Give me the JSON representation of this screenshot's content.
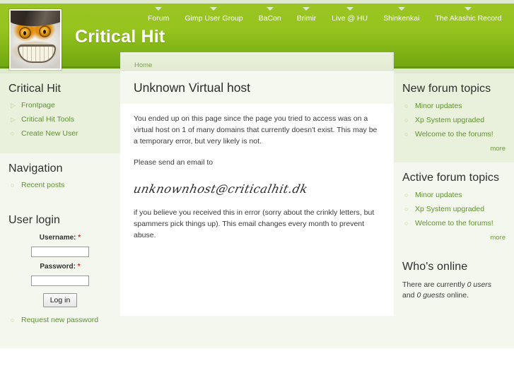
{
  "header": {
    "site_title": "Critical Hit",
    "logo_alt": "cat-mascot-logo",
    "nav": [
      {
        "label": "Forum"
      },
      {
        "label": "Gimp User Group"
      },
      {
        "label": "BaCon"
      },
      {
        "label": "Brimir"
      },
      {
        "label": "Live @ HU"
      },
      {
        "label": "Shinkenkai"
      },
      {
        "label": "The Akashic Record"
      }
    ]
  },
  "breadcrumb": {
    "items": [
      {
        "label": "Home"
      }
    ]
  },
  "main": {
    "title": "Unknown Virtual host",
    "paragraph1": "You ended up on this page since the page you tried to access was on a virtual host on 1 of many domains that currently doesn't exist. This may be a temporary error, but very likely is not.",
    "paragraph2": "Please send an email to",
    "email": "unknownhost@criticalhit.dk",
    "paragraph3": "if you believe you received this in error (sorry about the crinkly letters, but spammers pick things up). This email changes every month to prevent abuse."
  },
  "sidebar_left": {
    "blocks": [
      {
        "title": "Critical Hit",
        "items": [
          {
            "label": "Frontpage",
            "bullet": "triangle-right-icon"
          },
          {
            "label": "Critical Hit Tools",
            "bullet": "triangle-right-icon"
          },
          {
            "label": "Create New User",
            "bullet": "circle-icon"
          }
        ]
      },
      {
        "title": "Navigation",
        "items": [
          {
            "label": "Recent posts",
            "bullet": "circle-icon"
          }
        ]
      }
    ],
    "login": {
      "title": "User login",
      "username_label": "Username:",
      "username_value": "",
      "username_required": "*",
      "password_label": "Password:",
      "password_value": "",
      "password_required": "*",
      "submit_label": "Log in",
      "request_password_label": "Request new password",
      "request_password_bullet": "circle-icon"
    }
  },
  "sidebar_right": {
    "blocks": [
      {
        "title": "New forum topics",
        "items": [
          {
            "label": "Minor updates",
            "bullet": "circle-icon"
          },
          {
            "label": "Xp System upgraded",
            "bullet": "circle-icon"
          },
          {
            "label": "Welcome to the forums!",
            "bullet": "circle-icon"
          }
        ],
        "more_label": "more"
      },
      {
        "title": "Active forum topics",
        "items": [
          {
            "label": "Minor updates",
            "bullet": "circle-icon"
          },
          {
            "label": "Xp System upgraded",
            "bullet": "circle-icon"
          },
          {
            "label": "Welcome to the forums!",
            "bullet": "circle-icon"
          }
        ],
        "more_label": "more"
      }
    ],
    "whos_online": {
      "title": "Who's online",
      "text_prefix": "There are currently ",
      "users_count": "0 users",
      "text_middle": " and ",
      "guests_count": "0 guests",
      "text_suffix": " online."
    }
  },
  "colors": {
    "brand_green": "#97c41f",
    "link_green": "#5f9130",
    "header_strip": "#dfe9cd",
    "block_tint": "#e9f0dc",
    "page_bg": "#f4f7ee",
    "required_red": "#c0392b"
  }
}
